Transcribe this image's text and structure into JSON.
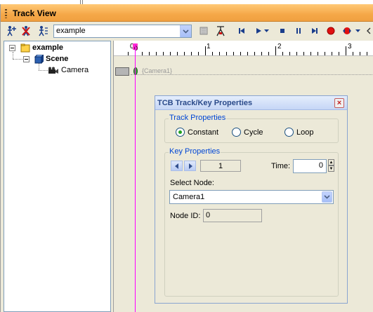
{
  "window": {
    "title": "Track View"
  },
  "toolbar": {
    "node_combo_value": "example",
    "icons": [
      "add-key-icon",
      "delete-key-icon",
      "key-props-icon",
      "lock-icon",
      "snap-icon",
      "go-start-icon",
      "play-icon",
      "play-options-icon",
      "stop-icon",
      "pause-icon",
      "go-end-icon",
      "record-icon",
      "record-options-icon",
      "more-icon"
    ]
  },
  "tree": {
    "items": [
      {
        "label": "example",
        "icon": "folder-icon"
      },
      {
        "label": "Scene",
        "icon": "scene-icon"
      },
      {
        "label": "Camera",
        "icon": "camera-icon"
      }
    ]
  },
  "timeline": {
    "ruler_labels": [
      "0",
      "1",
      "2",
      "3"
    ],
    "cursor_label": "0",
    "track_name": "{Camera1}"
  },
  "dialog": {
    "title": "TCB Track/Key Properties",
    "close_label": "×",
    "track_properties": {
      "legend": "Track Properties",
      "options": [
        "Constant",
        "Cycle",
        "Loop"
      ],
      "selected": "Constant"
    },
    "key_properties": {
      "legend": "Key Properties",
      "key_index": "1",
      "time_label": "Time:",
      "time_value": "0",
      "select_node_label": "Select Node:",
      "select_node_value": "Camera1",
      "node_id_label": "Node ID:",
      "node_id_value": "0"
    }
  },
  "colors": {
    "titlebar": "#f5a848",
    "cursor": "#ff00ff",
    "legend_text": "#0046d5",
    "key_oval": "#3c9f3c"
  }
}
